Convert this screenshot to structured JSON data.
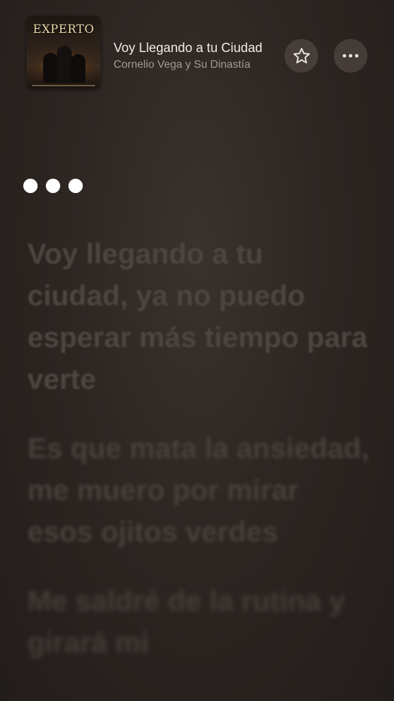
{
  "now_playing": {
    "album_cover_text": "EXPERTO",
    "title": "Voy Llegando a tu Ciudad",
    "artist": "Cornelio Vega y Su Dinastía"
  },
  "actions": {
    "favorite_icon": "star-outline-icon",
    "more_icon": "ellipsis-icon"
  },
  "lyrics": [
    "Voy llegando a tu ciudad, ya no puedo esperar más tiempo para verte",
    "Es que mata la ansiedad, me muero por mirar esos ojitos verdes",
    "Me saldré de la rutina y girará mi"
  ],
  "colors": {
    "background": "#2a2421",
    "interlude_dots": "#ffffff",
    "inactive_lyric": "#4c4440"
  }
}
